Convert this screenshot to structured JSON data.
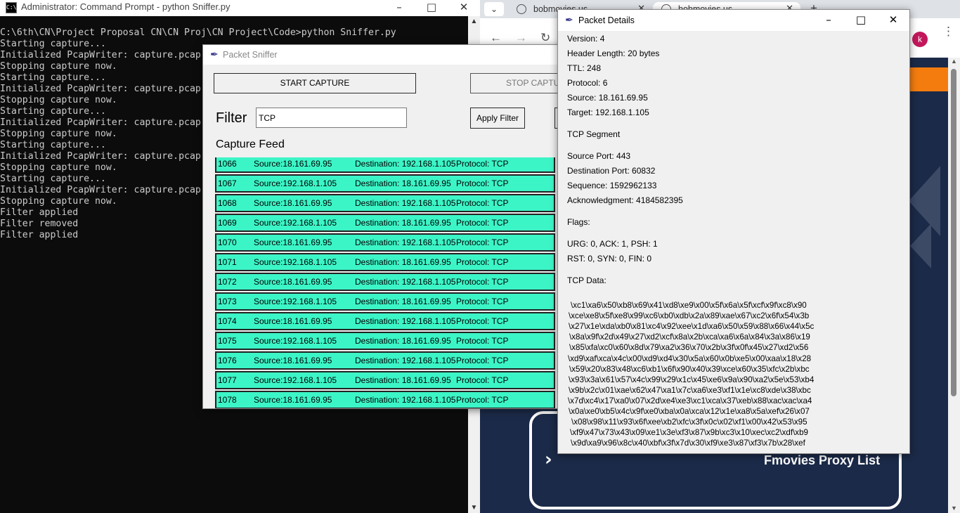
{
  "cmd": {
    "title": "Administrator: Command Prompt - python  Sniffer.py",
    "icon_text": "C:\\",
    "lines": [
      "C:\\6th\\CN\\Project Proposal CN\\CN Proj\\CN Project\\Code>python Sniffer.py",
      "Starting capture...",
      "Initialized PcapWriter: capture.pcap",
      "Stopping capture now.",
      "Starting capture...",
      "Initialized PcapWriter: capture.pcap",
      "Stopping capture now.",
      "Starting capture...",
      "Initialized PcapWriter: capture.pcap",
      "Stopping capture now.",
      "Starting capture...",
      "Initialized PcapWriter: capture.pcap",
      "Stopping capture now.",
      "Starting capture...",
      "Initialized PcapWriter: capture.pcap",
      "Stopping capture now.",
      "Filter applied",
      "Filter removed",
      "Filter applied"
    ]
  },
  "browser": {
    "tabs": [
      {
        "label": "bobmovies.us"
      },
      {
        "label": "bobmovies.us"
      }
    ],
    "profile_initial": "k",
    "proxy_card_text": "Fmovies Proxy List",
    "colors": {
      "page_bg": "#1b2a48",
      "accent": "#f47c0f"
    }
  },
  "sniffer": {
    "title": "Packet Sniffer",
    "start_label": "START CAPTURE",
    "stop_label": "STOP CAPTURE",
    "filter_label": "Filter",
    "filter_value": "TCP",
    "apply_label": "Apply Filter",
    "feed_label": "Capture Feed",
    "row_color": "#3cf5c7",
    "packets": [
      {
        "id": "1066",
        "src": "Source:18.161.69.95",
        "dst": "Destination: 192.168.1.105",
        "proto": "Protocol: TCP"
      },
      {
        "id": "1067",
        "src": "Source:192.168.1.105",
        "dst": "Destination: 18.161.69.95",
        "proto": "Protocol: TCP"
      },
      {
        "id": "1068",
        "src": "Source:18.161.69.95",
        "dst": "Destination: 192.168.1.105",
        "proto": "Protocol: TCP"
      },
      {
        "id": "1069",
        "src": "Source:192.168.1.105",
        "dst": "Destination: 18.161.69.95",
        "proto": "Protocol: TCP"
      },
      {
        "id": "1070",
        "src": "Source:18.161.69.95",
        "dst": "Destination: 192.168.1.105",
        "proto": "Protocol: TCP"
      },
      {
        "id": "1071",
        "src": "Source:192.168.1.105",
        "dst": "Destination: 18.161.69.95",
        "proto": "Protocol: TCP"
      },
      {
        "id": "1072",
        "src": "Source:18.161.69.95",
        "dst": "Destination: 192.168.1.105",
        "proto": "Protocol: TCP"
      },
      {
        "id": "1073",
        "src": "Source:192.168.1.105",
        "dst": "Destination: 18.161.69.95",
        "proto": "Protocol: TCP"
      },
      {
        "id": "1074",
        "src": "Source:18.161.69.95",
        "dst": "Destination: 192.168.1.105",
        "proto": "Protocol: TCP"
      },
      {
        "id": "1075",
        "src": "Source:192.168.1.105",
        "dst": "Destination: 18.161.69.95",
        "proto": "Protocol: TCP"
      },
      {
        "id": "1076",
        "src": "Source:18.161.69.95",
        "dst": "Destination: 192.168.1.105",
        "proto": "Protocol: TCP"
      },
      {
        "id": "1077",
        "src": "Source:192.168.1.105",
        "dst": "Destination: 18.161.69.95",
        "proto": "Protocol: TCP"
      },
      {
        "id": "1078",
        "src": "Source:18.161.69.95",
        "dst": "Destination: 192.168.1.105",
        "proto": "Protocol: TCP"
      }
    ]
  },
  "details": {
    "title": "Packet Details",
    "fields": [
      "Version: 4",
      "Header Length: 20 bytes",
      "TTL: 248",
      "Protocol: 6",
      "Source: 18.161.69.95",
      "Target: 192.168.1.105",
      "TCP Segment",
      "Source Port: 443",
      "Destination Port: 60832",
      "Sequence: 1592962133",
      "Acknowledgment: 4184582395",
      "Flags:",
      "URG: 0, ACK: 1, PSH: 1",
      "RST: 0, SYN: 0, FIN: 0",
      "TCP Data:"
    ],
    "tcp_data": [
      "\\xc1\\xa6\\x50\\xb8\\x69\\x41\\xd8\\xe9\\x00\\x5f\\x6a\\x5f\\xcf\\x9f\\xc8\\x90",
      "\\xce\\xe8\\x5f\\xe8\\x99\\xc6\\xb0\\xdb\\x2a\\x89\\xae\\x67\\xc2\\x6f\\x54\\x3b",
      "\\x27\\x1e\\xda\\xb0\\x81\\xc4\\x92\\xee\\x1d\\xa6\\x50\\x59\\x88\\x66\\x44\\x5c",
      "\\x8a\\x9f\\x2d\\x49\\x27\\xd2\\xcf\\x8a\\x2b\\xca\\xa6\\x6a\\x84\\x3a\\x86\\x19",
      "\\x85\\xfa\\xc0\\x60\\x8d\\x79\\xa2\\x36\\x70\\x2b\\x3f\\x0f\\x45\\x27\\xd2\\x56",
      "\\xd9\\xaf\\xca\\x4c\\x00\\xd9\\xd4\\x30\\x5a\\x60\\x0b\\xe5\\x00\\xaa\\x18\\x28",
      "\\x59\\x20\\x83\\x48\\xc6\\xb1\\x6f\\x90\\x40\\x39\\xce\\x60\\x35\\xfc\\x2b\\xbc",
      "\\x93\\x3a\\x61\\x57\\x4c\\x99\\x29\\x1c\\x45\\xe6\\x9a\\x90\\xa2\\x5e\\x53\\xb4",
      "\\x9b\\x2c\\x01\\xae\\x62\\x47\\xa1\\x7c\\xa6\\xe3\\xf1\\x1e\\xc8\\xde\\x38\\xbc",
      "\\x7d\\xc4\\x17\\xa0\\x07\\x2d\\xe4\\xe3\\xc1\\xca\\x37\\xeb\\x88\\xac\\xac\\xa4",
      "\\x0a\\xe0\\xb5\\x4c\\x9f\\xe0\\xba\\x0a\\xca\\x12\\x1e\\xa8\\x5a\\xef\\x26\\x07",
      "\\x08\\x98\\x11\\x93\\x6f\\xee\\xb2\\xfc\\x3f\\x0c\\x02\\xf1\\x00\\x42\\x53\\x95",
      "\\xf9\\x47\\x73\\x43\\x09\\xe1\\x3e\\xf3\\x87\\x9b\\xc3\\x10\\xec\\xc2\\xdf\\xb9",
      "\\x9d\\xa9\\x96\\x8c\\x40\\xbf\\x3f\\x7d\\x30\\xf9\\xe3\\x87\\xf3\\x7b\\x28\\xef"
    ]
  }
}
